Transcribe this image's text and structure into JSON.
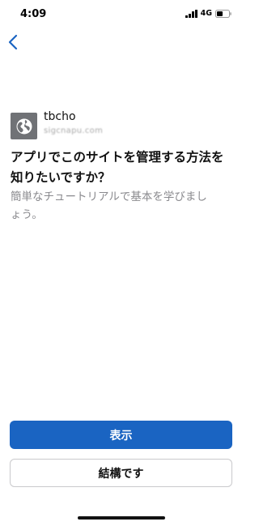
{
  "status_bar": {
    "time": "4:09",
    "network": "4G",
    "signal_bars": 4,
    "battery_level": 0.5
  },
  "nav": {
    "back_icon": "chevron-left-icon",
    "accent_color": "#1a64c2"
  },
  "site": {
    "icon": "globe-icon",
    "name": "tbcho",
    "url": "sigcnapu.com"
  },
  "prompt": {
    "headline": "アプリでこのサイトを管理する方法を知りたいですか？",
    "subtext": "簡単なチュートリアルで基本を学びましょう。"
  },
  "actions": {
    "show_label": "表示",
    "dismiss_label": "結構です"
  }
}
